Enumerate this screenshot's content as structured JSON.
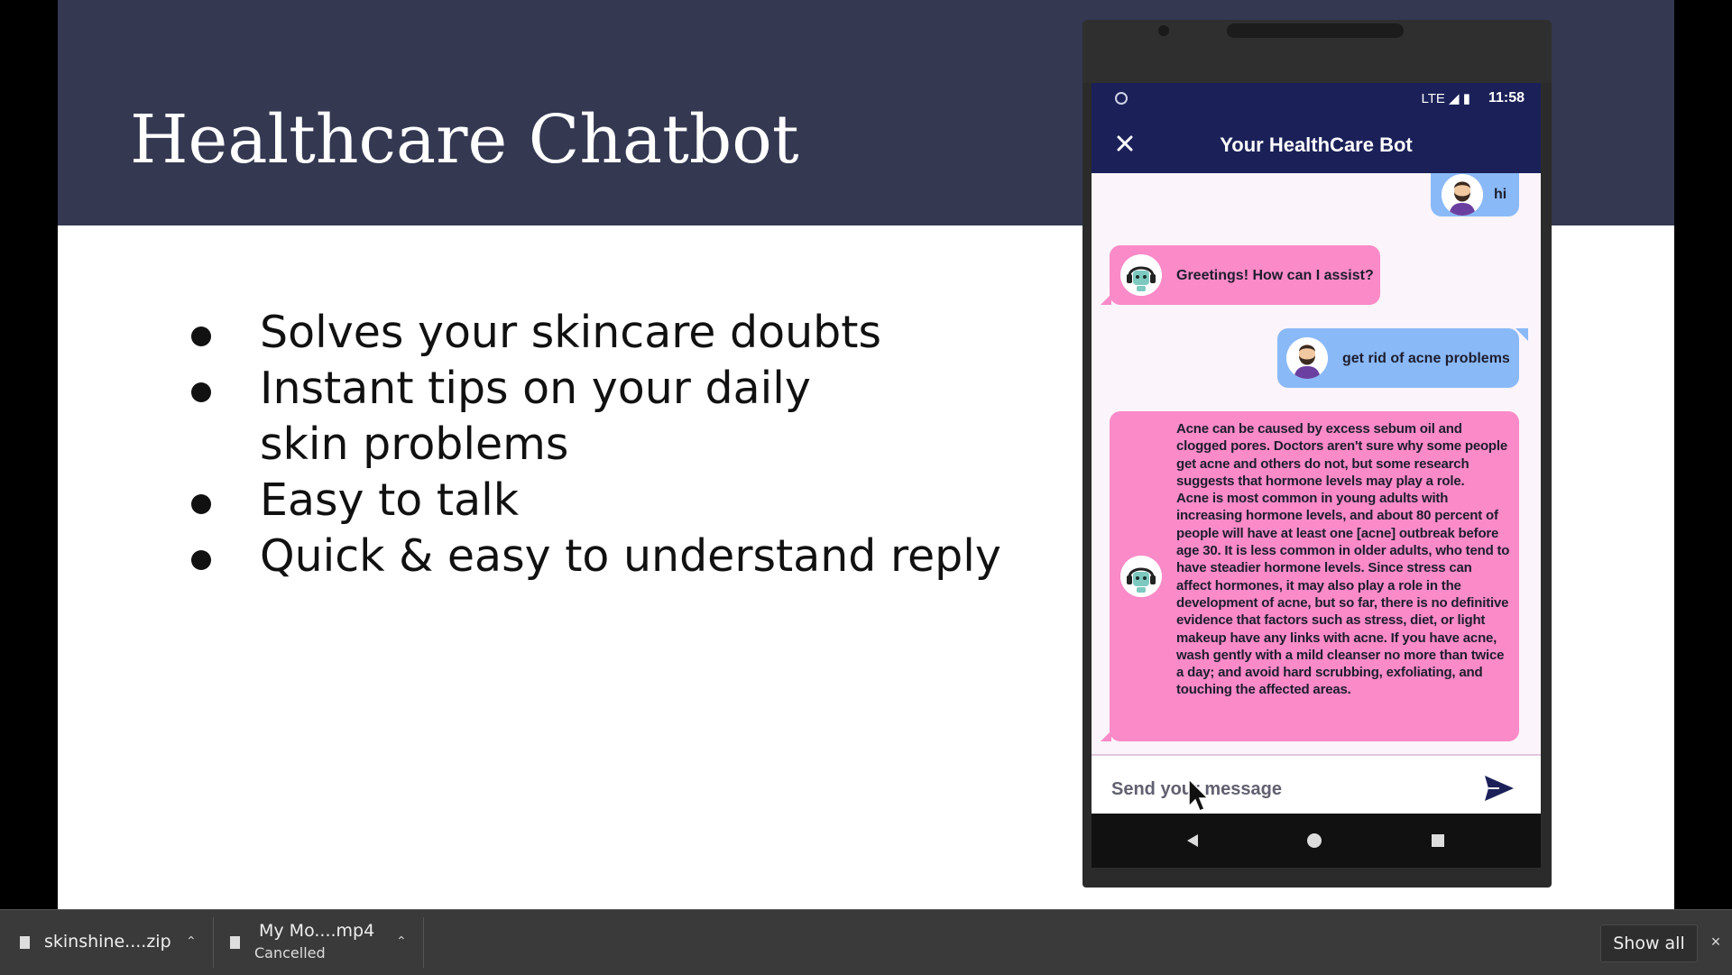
{
  "slide": {
    "title": "Healthcare Chatbot",
    "bullets": [
      "Solves your skincare doubts",
      "Instant tips on your daily skin problems",
      "Easy to talk",
      "Quick & easy to understand reply"
    ]
  },
  "phone": {
    "status_time": "11:58",
    "status_icons": "LTE ◢ ▮",
    "app_title": "Your HealthCare Bot",
    "messages": [
      {
        "sender": "user",
        "text": "hi"
      },
      {
        "sender": "bot",
        "text": "Greetings! How can I assist?"
      },
      {
        "sender": "user",
        "text": "get rid of acne problems"
      },
      {
        "sender": "bot",
        "text": "Acne can be caused by excess sebum oil and clogged pores. Doctors aren't sure why some people get acne and others do not, but some research suggests that hormone levels may play a role.\nAcne is most common in young adults with increasing hormone levels, and about 80 percent of people will have at least one [acne] outbreak before age 30. It is less common in older adults, who tend to have steadier hormone levels. Since stress can affect hormones, it may also play a role in the development of acne, but so far, there is no definitive evidence that factors such as stress, diet, or light makeup have any links with acne. If you have acne, wash gently with a mild cleanser no more than twice a day; and avoid hard scrubbing, exfoliating, and touching the affected areas."
      }
    ],
    "input_placeholder": "Send your message"
  },
  "downloads": {
    "items": [
      {
        "name": "skinshine....zip",
        "status": ""
      },
      {
        "name": "My Mo....mp4",
        "status": "Cancelled"
      }
    ],
    "show_all_label": "Show all",
    "close_label": "×"
  },
  "colors": {
    "header_bg": "#343851",
    "app_bar": "#1b2158",
    "user_bubble": "#8ab9f8",
    "bot_bubble": "#fa8ac8",
    "download_bar": "#3a3a3a"
  },
  "icons": {
    "close": "close-icon",
    "send": "send-icon",
    "nav_back": "back-triangle-icon",
    "nav_home": "home-circle-icon",
    "nav_recent": "recent-square-icon",
    "file": "file-icon",
    "chevron": "chevron-up-icon"
  }
}
